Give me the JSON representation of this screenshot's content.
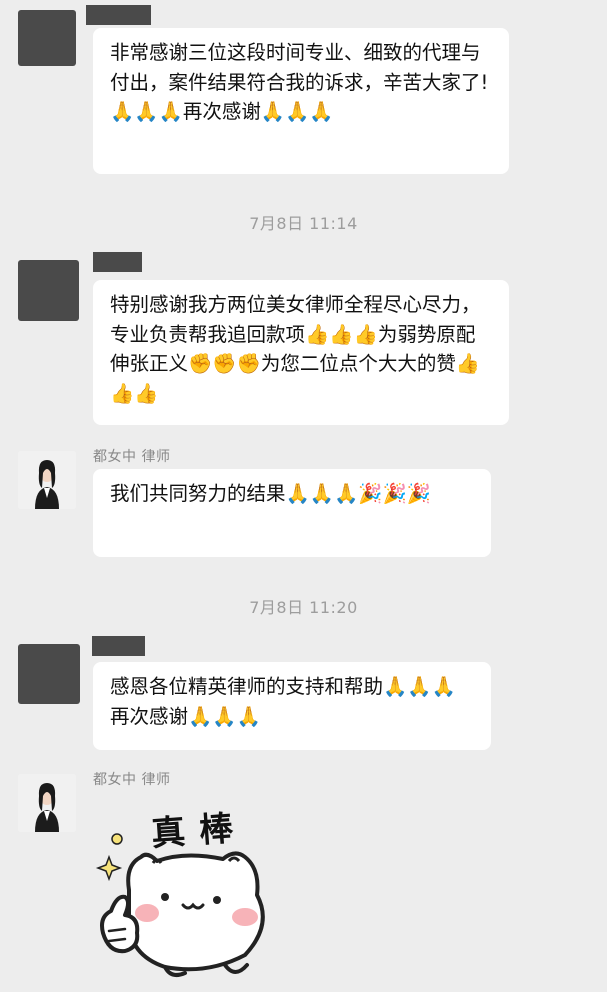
{
  "messages": [
    {
      "type": "text",
      "side": "left",
      "sender_hidden": true,
      "text": "非常感谢三位这段时间专业、细致的代理与付出，案件结果符合我的诉求，辛苦大家了!🙏🙏🙏再次感谢🙏🙏🙏"
    },
    {
      "type": "timestamp",
      "text": "7月8日 11:14"
    },
    {
      "type": "text",
      "side": "left",
      "sender_hidden": true,
      "text": "特别感谢我方两位美女律师全程尽心尽力，专业负责帮我追回款项👍👍👍为弱势原配伸张正义✊✊✊为您二位点个大大的赞👍👍👍"
    },
    {
      "type": "text",
      "side": "left",
      "sender": "都女中 律师",
      "text": "我们共同努力的结果🙏🙏🙏🎉🎉🎉"
    },
    {
      "type": "timestamp",
      "text": "7月8日 11:20"
    },
    {
      "type": "text",
      "side": "left",
      "sender_hidden": true,
      "text": "感恩各位精英律师的支持和帮助🙏🙏🙏再次感谢🙏🙏🙏"
    },
    {
      "type": "sticker",
      "side": "left",
      "sender": "都女中 律师",
      "sticker_text": "真棒"
    }
  ],
  "icons": {
    "hidden_avatar": "redacted-avatar",
    "lawyer_avatar": "lawyer-avatar",
    "sticker": "cat-thumbs-up-sticker"
  },
  "colors": {
    "background": "#ededed",
    "bubble": "#ffffff",
    "timestamp": "#9d9d9d",
    "redaction": "#4a4a4a"
  }
}
